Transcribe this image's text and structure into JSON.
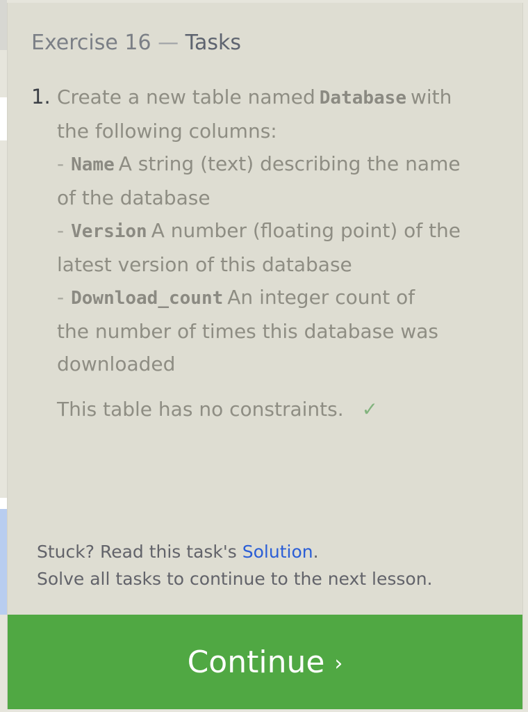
{
  "panel": {
    "title_prefix": "Exercise 16",
    "title_separator": "—",
    "title_main": "Tasks"
  },
  "task": {
    "number": "1.",
    "intro_1": "Create a new table named",
    "table_name": "Database",
    "intro_2": "with",
    "intro_3": "the following columns:",
    "columns": [
      {
        "dash": "-",
        "name": "Name",
        "desc_1": "A string (text) describing the name",
        "desc_2": "of the database"
      },
      {
        "dash": "-",
        "name": "Version",
        "desc_1": "A number (floating point) of the",
        "desc_2": "latest version of this database"
      },
      {
        "dash": "-",
        "name": "Download_count",
        "desc_1": "An integer count of",
        "desc_2": "the number of times this database was",
        "desc_3": "downloaded"
      }
    ],
    "note": "This table has no constraints.",
    "check_icon": "✓",
    "check_color": "#82b37e"
  },
  "help": {
    "stuck_prefix": "Stuck? Read this task's",
    "solution_link": "Solution",
    "stuck_suffix": ".",
    "solve_all": "Solve all tasks to continue to the next lesson."
  },
  "continue_button": {
    "label": "Continue",
    "chevron": "›",
    "color": "#50a843"
  }
}
